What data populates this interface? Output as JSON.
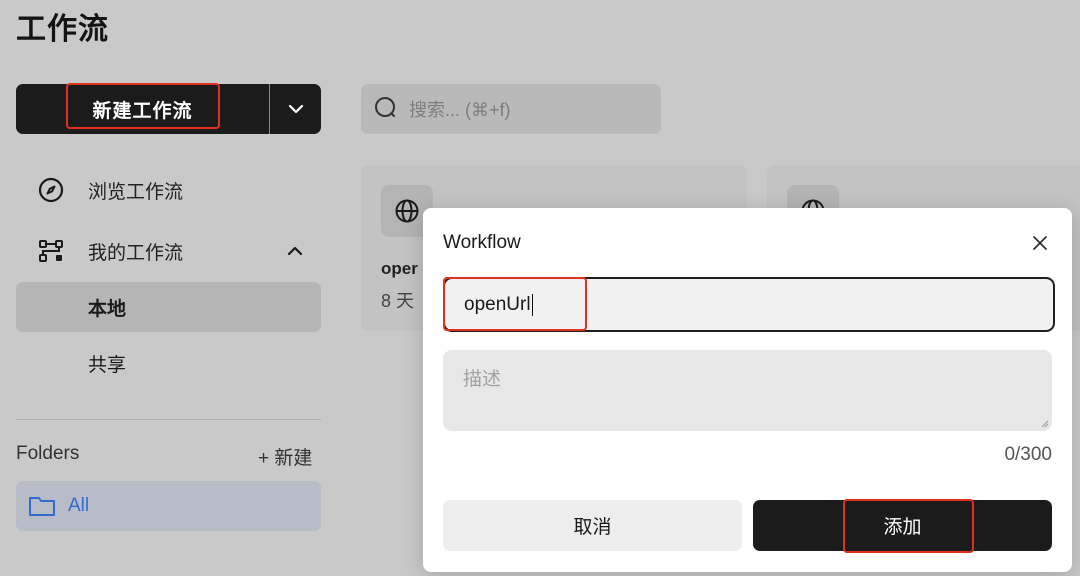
{
  "page": {
    "title": "工作流"
  },
  "toolbar": {
    "new_workflow_label": "新建工作流",
    "search_placeholder": "搜索... (⌘+f)"
  },
  "sidebar": {
    "browse_label": "浏览工作流",
    "my_workflows_label": "我的工作流",
    "sub_items": [
      {
        "label": "本地",
        "selected": true
      },
      {
        "label": "共享",
        "selected": false
      }
    ],
    "folders_label": "Folders",
    "new_folder_label": "+ 新建",
    "folders": [
      {
        "label": "All",
        "selected": true
      }
    ]
  },
  "cards": [
    {
      "title": "oper",
      "subtitle": "8 天"
    },
    {
      "title": "",
      "subtitle": ""
    }
  ],
  "dialog": {
    "title": "Workflow",
    "name_value": "openUrl",
    "description_placeholder": "描述",
    "char_count": "0/300",
    "cancel_label": "取消",
    "add_label": "添加"
  },
  "colors": {
    "primary_dark": "#1b1b1b",
    "highlight_red": "#e0311f",
    "folder_blue": "#2f6bd2"
  }
}
